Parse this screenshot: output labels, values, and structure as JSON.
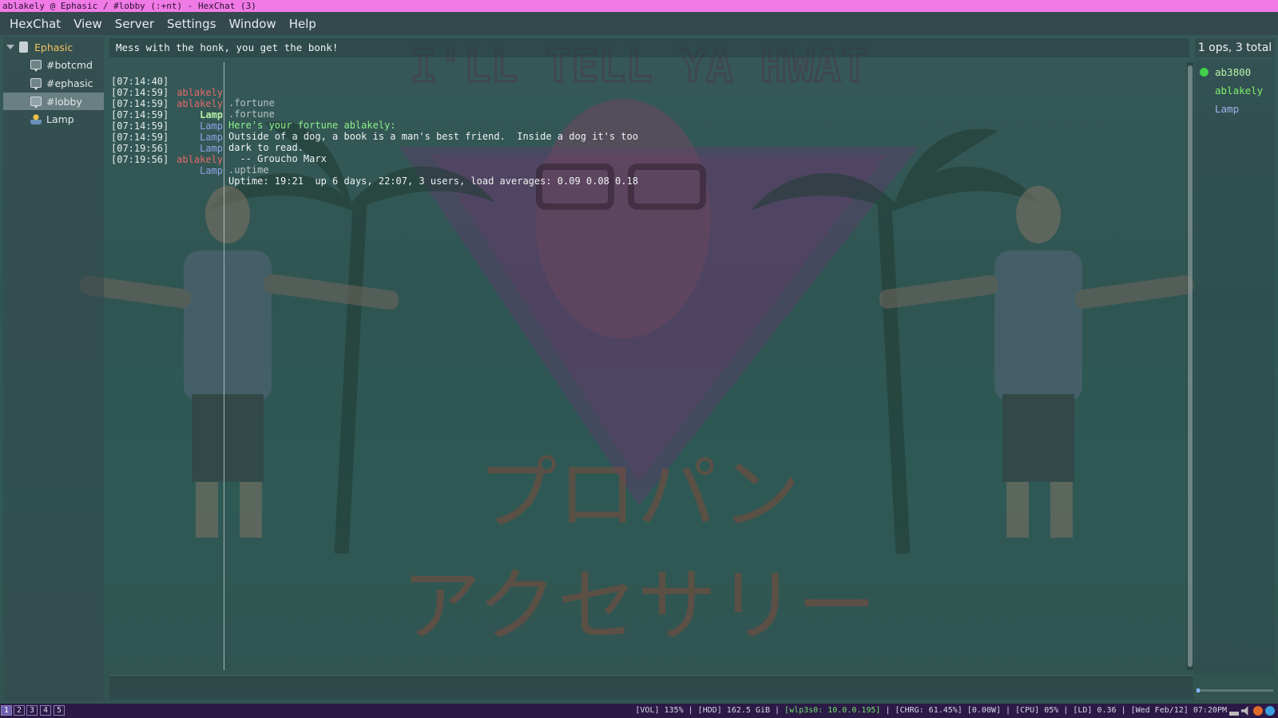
{
  "window": {
    "title": "ablakely @ Ephasic / #lobby (:+nt) - HexChat (3)"
  },
  "menu": [
    "HexChat",
    "View",
    "Server",
    "Settings",
    "Window",
    "Help"
  ],
  "tree": {
    "server": "Ephasic",
    "items": [
      {
        "label": "#botcmd",
        "icon": "channel-icon"
      },
      {
        "label": "#ephasic",
        "icon": "channel-icon"
      },
      {
        "label": "#lobby",
        "icon": "channel-icon",
        "selected": true
      },
      {
        "label": "Lamp",
        "icon": "user-icon"
      }
    ]
  },
  "topic": "Mess with the honk, you get the bonk!",
  "chat": [
    {
      "time": "[07:14:40]",
      "nick": "ablakely",
      "text": ".fortune"
    },
    {
      "time": "[07:14:59]",
      "nick": "ablakely",
      "text": ".fortune"
    },
    {
      "time": "[07:14:59]",
      "nick": "Lamp",
      "text": "Here's your fortune ablakely:"
    },
    {
      "time": "[07:14:59]",
      "nick": "Lamp",
      "text": "Outside of a dog, a book is a man's best friend.  Inside a dog it's too"
    },
    {
      "time": "[07:14:59]",
      "nick": "Lamp",
      "text": "dark to read."
    },
    {
      "time": "[07:14:59]",
      "nick": "Lamp",
      "text": "  -- Groucho Marx"
    },
    {
      "time": "[07:19:56]",
      "nick": "ablakely",
      "text": ".uptime"
    },
    {
      "time": "[07:19:56]",
      "nick": "Lamp",
      "text": "Uptime: 19:21  up 6 days, 22:07, 3 users, load averages: 0.09 0.08 0.18"
    }
  ],
  "userlist": {
    "header": "1 ops, 3 total",
    "users": [
      "ab3800",
      "ablakely",
      "Lamp"
    ]
  },
  "background": {
    "headline": "I'LL TELL YA HWAT",
    "japanese_line1": "プロパン",
    "japanese_line2": "アクセサリー"
  },
  "statusbar": {
    "workspaces": [
      "1",
      "2",
      "3",
      "4",
      "5"
    ],
    "vol": "[VOL] 135%",
    "hdd": "[HDD] 162.5 GiB",
    "net": "[wlp3s0: 10.0.0.195]",
    "chrg": "[CHRG: 61.45%]",
    "watt": "[0.00W]",
    "cpu": "[CPU] 05%",
    "ld": "[LD] 0.36",
    "date": "[Wed Feb/12] 07:20PM"
  },
  "colors": {
    "titlebar": "#f07ae6",
    "nick_ablakely": "#e46a6a",
    "nick_lamp": "#8fa3e8",
    "op_indicator": "#41d04a"
  }
}
